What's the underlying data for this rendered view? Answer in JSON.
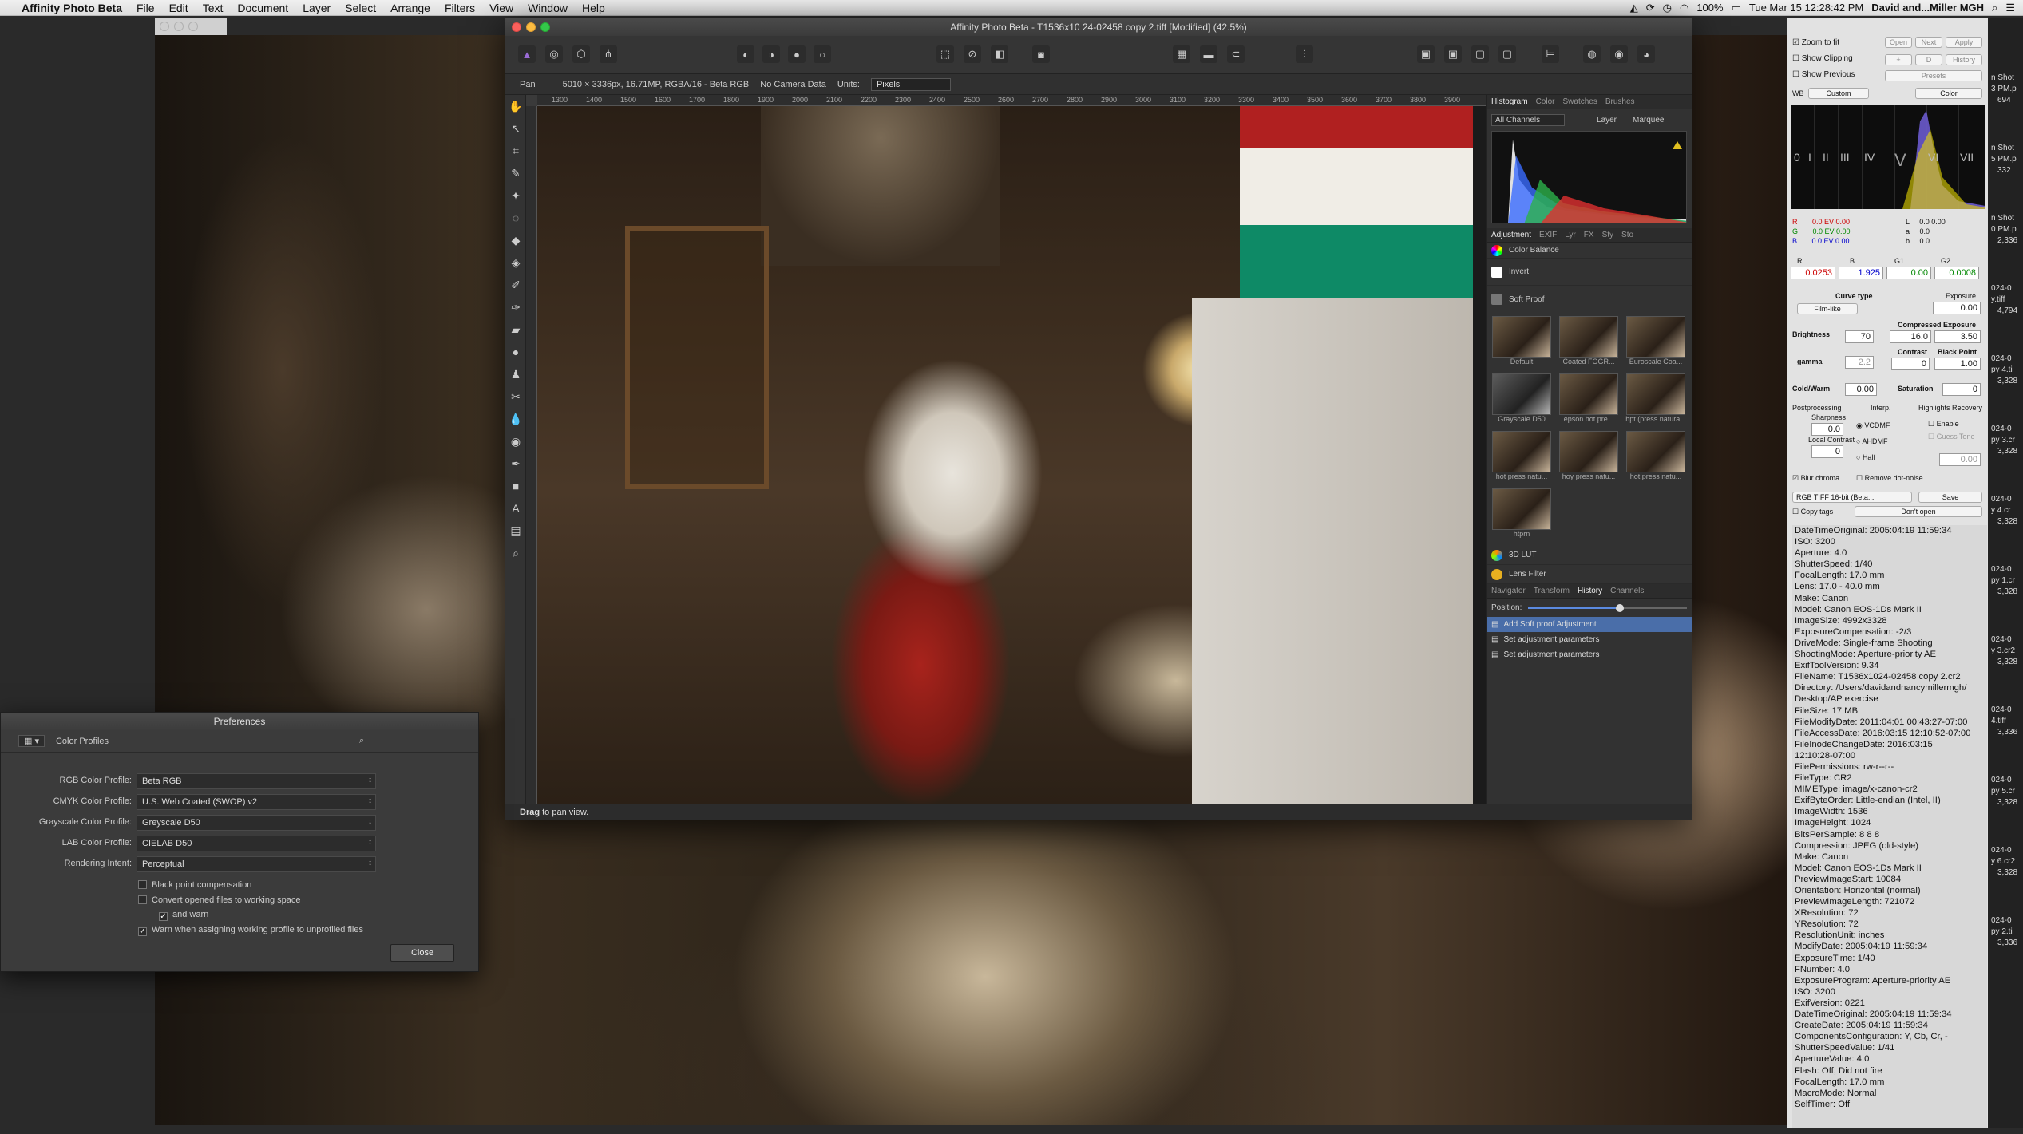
{
  "menubar": {
    "app": "Affinity Photo Beta",
    "items": [
      "File",
      "Edit",
      "Text",
      "Document",
      "Layer",
      "Select",
      "Arrange",
      "Filters",
      "View",
      "Window",
      "Help"
    ],
    "battery": "100%",
    "clock": "Tue Mar 15  12:28:42 PM",
    "user": "David and...Miller MGH"
  },
  "main_window": {
    "title": "Affinity Photo Beta - T1536x10        24-02458 copy 2.tiff [Modified] (42.5%)"
  },
  "context_bar": {
    "tool": "Pan",
    "dims": "5010 × 3336px, 16.71MP, RGBA/16 - Beta RGB",
    "camera": "No Camera Data",
    "units_label": "Units:",
    "units_value": "Pixels"
  },
  "ruler_ticks": [
    "1300",
    "1400",
    "1500",
    "1600",
    "1700",
    "1800",
    "1900",
    "2000",
    "2100",
    "2200",
    "2300",
    "2400",
    "2500",
    "2600",
    "2700",
    "2800",
    "2900",
    "3000",
    "3100",
    "3200",
    "3300",
    "3400",
    "3500",
    "3600",
    "3700",
    "3800",
    "3900"
  ],
  "status": {
    "bold": "Drag",
    "rest": "to pan view."
  },
  "right_panel": {
    "tabs1": [
      "Histogram",
      "Color",
      "Swatches",
      "Brushes"
    ],
    "channels": "All Channels",
    "layer": "Layer",
    "marquee": "Marquee",
    "tabs2": [
      "Adjustment",
      "EXIF",
      "Lyr",
      "FX",
      "Sty",
      "Sto"
    ],
    "adjustments": [
      "Color Balance",
      "Invert",
      "Soft Proof"
    ],
    "presets": [
      "Default",
      "Coated FOGR...",
      "Euroscale Coa...",
      "Grayscale D50",
      "epson hot pre...",
      "hpt (press natura...",
      "hot press natu...",
      "hoy press natu...",
      "hot press natu...",
      "htprn"
    ],
    "adjustments2": [
      "3D LUT",
      "Lens Filter"
    ],
    "tabs3": [
      "Navigator",
      "Transform",
      "History",
      "Channels"
    ],
    "position_label": "Position:",
    "history": [
      "Add Soft proof Adjustment",
      "Set adjustment parameters",
      "Set adjustment parameters"
    ]
  },
  "prefs": {
    "title": "Preferences",
    "section": "Color Profiles",
    "rows": [
      {
        "label": "RGB Color Profile:",
        "value": "Beta RGB"
      },
      {
        "label": "CMYK Color Profile:",
        "value": "U.S. Web Coated (SWOP) v2"
      },
      {
        "label": "Grayscale Color Profile:",
        "value": "Greyscale D50"
      },
      {
        "label": "LAB Color Profile:",
        "value": "CIELAB D50"
      },
      {
        "label": "Rendering Intent:",
        "value": "Perceptual"
      }
    ],
    "checks": [
      {
        "label": "Black point compensation",
        "checked": false
      },
      {
        "label": "Convert opened files to working space",
        "checked": false
      },
      {
        "label": "and warn",
        "checked": true
      },
      {
        "label": "Warn when assigning working profile to unprofiled files",
        "checked": true
      }
    ],
    "close": "Close"
  },
  "raw": {
    "zoom_to_fit": "Zoom to fit",
    "show_clipping": "Show Clipping",
    "show_previous": "Show Previous",
    "btns": [
      "Open",
      "Next",
      "Apply",
      "History",
      "Presets"
    ],
    "wb": "WB",
    "wb_value": "Custom",
    "color": "Color",
    "zones": [
      "0",
      "I",
      "II",
      "III",
      "IV",
      "V",
      "VI",
      "VII"
    ],
    "rgb_rows": [
      {
        "ch": "R",
        "ev": "0.0 EV 0.00",
        "l": "L",
        "lv": "0.0",
        "lv2": "0.00"
      },
      {
        "ch": "G",
        "ev": "0.0 EV 0.00",
        "l": "a",
        "lv": "0.0",
        "lv2": ""
      },
      {
        "ch": "B",
        "ev": "0.0 EV 0.00",
        "l": "b",
        "lv": "0.0",
        "lv2": ""
      }
    ],
    "mult_labels": [
      "R",
      "B",
      "G1",
      "G2"
    ],
    "mult_values": [
      "0.0253",
      "1.925",
      "0.00",
      "0.0008"
    ],
    "curve_type": "Curve type",
    "curve_value": "Film-like",
    "exposure_label": "Exposure",
    "exposure": "0.00",
    "brightness_label": "Brightness",
    "brightness": "70",
    "compressed_label": "Compressed Exposure",
    "compressed_a": "16.0",
    "compressed_b": "3.50",
    "gamma_label": "gamma",
    "gamma": "2.2",
    "contrast_label": "Contrast",
    "contrast": "0",
    "black_label": "Black Point",
    "black": "1.00",
    "coldwarm_label": "Cold/Warm",
    "coldwarm": "0.00",
    "saturation_label": "Saturation",
    "saturation": "0",
    "post_label": "Postprocessing",
    "interp_label": "Interp.",
    "hr_label": "Highlights Recovery",
    "sharp_label": "Sharpness",
    "sharp": "0.0",
    "localc_label": "Local Contrast",
    "localc": "0",
    "interp": [
      "VCDMF",
      "AHDMF",
      "Half"
    ],
    "enable": "Enable",
    "guess": "Guess Tone",
    "hr_val": "0.00",
    "blur_chroma": "Blur chroma",
    "remove_dot": "Remove dot-noise",
    "format": "RGB TIFF 16-bit (Beta...",
    "save": "Save",
    "copy_tags": "Copy tags",
    "dont_open": "Don't open",
    "exif": [
      "DateTimeOriginal: 2005:04:19 11:59:34",
      "ISO: 3200",
      "Aperture: 4.0",
      "ShutterSpeed: 1/40",
      "FocalLength: 17.0 mm",
      "Lens: 17.0 - 40.0 mm",
      "Make: Canon",
      "Model: Canon EOS-1Ds Mark II",
      "ImageSize: 4992x3328",
      "ExposureCompensation: -2/3",
      "DriveMode: Single-frame Shooting",
      "ShootingMode: Aperture-priority AE",
      "ExifToolVersion: 9.34",
      "FileName: T1536x1024-02458 copy 2.cr2",
      "Directory: /Users/davidandnancymillermgh/",
      "Desktop/AP exercise",
      "FileSize: 17 MB",
      "FileModifyDate: 2011:04:01 00:43:27-07:00",
      "FileAccessDate: 2016:03:15 12:10:52-07:00",
      "FileInodeChangeDate: 2016:03:15",
      "12:10:28-07:00",
      "FilePermissions: rw-r--r--",
      "FileType: CR2",
      "MIMEType: image/x-canon-cr2",
      "ExifByteOrder: Little-endian (Intel, II)",
      "ImageWidth: 1536",
      "ImageHeight: 1024",
      "BitsPerSample: 8 8 8",
      "Compression: JPEG (old-style)",
      "Make: Canon",
      "Model: Canon EOS-1Ds Mark II",
      "PreviewImageStart: 10084",
      "Orientation: Horizontal (normal)",
      "PreviewImageLength: 721072",
      "XResolution: 72",
      "YResolution: 72",
      "ResolutionUnit: inches",
      "ModifyDate: 2005:04:19 11:59:34",
      "ExposureTime: 1/40",
      "FNumber: 4.0",
      "ExposureProgram: Aperture-priority AE",
      "ISO: 3200",
      "ExifVersion: 0221",
      "DateTimeOriginal: 2005:04:19 11:59:34",
      "CreateDate: 2005:04:19 11:59:34",
      "ComponentsConfiguration: Y, Cb, Cr, -",
      "ShutterSpeedValue: 1/41",
      "ApertureValue: 4.0",
      "Flash: Off, Did not fire",
      "FocalLength: 17.0 mm",
      "MacroMode: Normal",
      "SelfTimer: Off"
    ]
  },
  "desktop_thumbs": [
    "n Shot",
    "3 PM.p",
    "694",
    "n Shot",
    "5 PM.p",
    "332",
    "n Shot",
    "0 PM.p",
    "2,336",
    "024-0",
    "y.tiff",
    "4,794",
    "024-0",
    "py 4.ti",
    "3,328",
    "024-0",
    "py 3.cr",
    "3,328",
    "024-0",
    "y 4.cr",
    "3,328",
    "024-0",
    "py 1.cr",
    "3,328",
    "024-0",
    "y 3.cr2",
    "3,328",
    "024-0",
    "4.tiff",
    "3,336",
    "024-0",
    "py 5.cr",
    "3,328",
    "024-0",
    "y 6.cr2",
    "3,328",
    "024-0",
    "py 2.ti",
    "3,336"
  ]
}
